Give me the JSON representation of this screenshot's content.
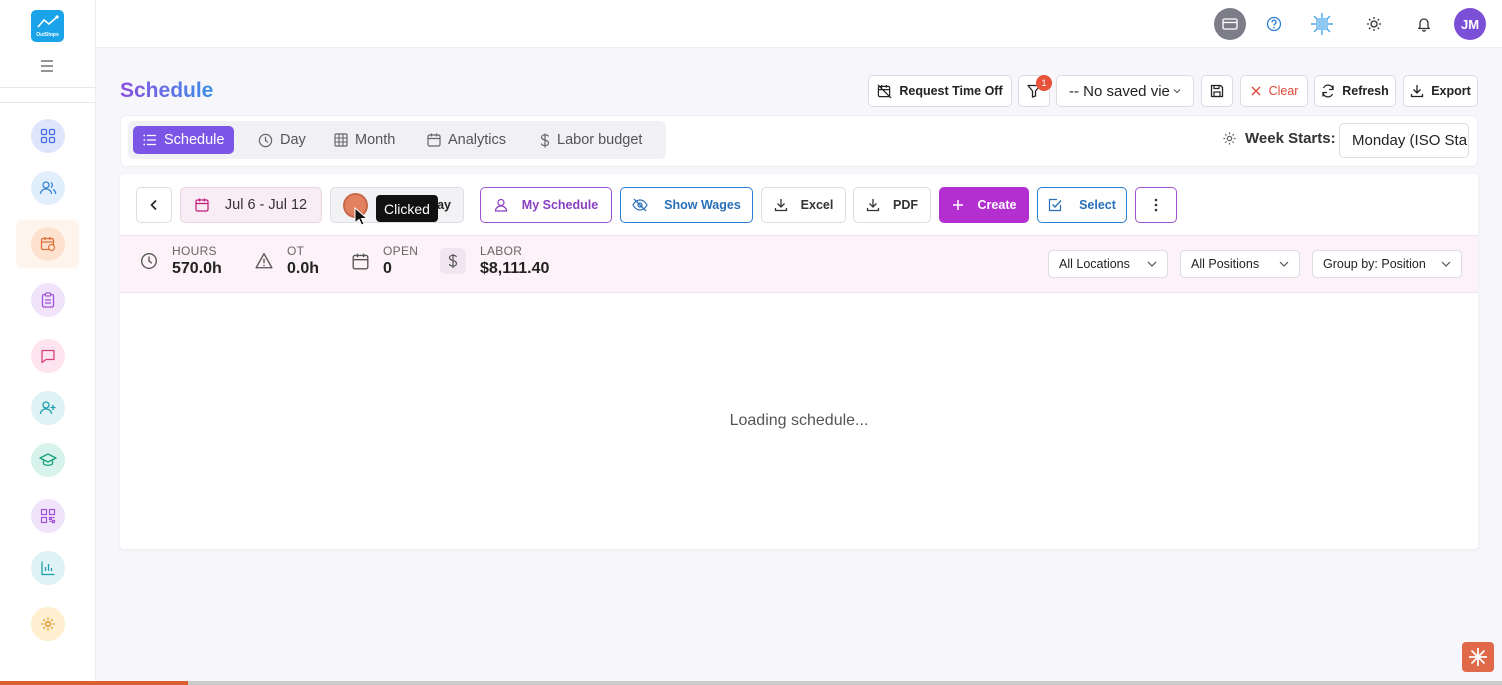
{
  "app": {
    "logo_text": "OutStops"
  },
  "topbar": {
    "avatar_initials": "JM"
  },
  "page": {
    "title": "Schedule"
  },
  "header_actions": {
    "request_time_off": "Request Time Off",
    "filter_badge": "1",
    "saved_view": "-- No saved vie",
    "clear": "Clear",
    "refresh": "Refresh",
    "export": "Export"
  },
  "tabs": [
    {
      "label": "Schedule",
      "icon": "list-icon",
      "active": true
    },
    {
      "label": "Day",
      "icon": "clock-icon"
    },
    {
      "label": "Month",
      "icon": "grid-icon"
    },
    {
      "label": "Analytics",
      "icon": "calendar-icon"
    },
    {
      "label": "Labor budget",
      "icon": "dollar-icon"
    }
  ],
  "week_starts": {
    "label": "Week Starts:",
    "value": "Monday (ISO Standard)"
  },
  "toolbar": {
    "date_range": "Jul 6 - Jul 12",
    "today_partial": "ay",
    "my_schedule": "My Schedule",
    "show_wages": "Show Wages",
    "excel": "Excel",
    "pdf": "PDF",
    "create": "Create",
    "select": "Select"
  },
  "stats": [
    {
      "label": "HOURS",
      "value": "570.0h",
      "icon": "clock-icon"
    },
    {
      "label": "OT",
      "value": "0.0h",
      "icon": "warning-icon"
    },
    {
      "label": "OPEN",
      "value": "0",
      "icon": "calendar-icon"
    },
    {
      "label": "LABOR",
      "value": "$8,111.40",
      "icon": "dollar-icon"
    }
  ],
  "filters": {
    "locations": "All Locations",
    "positions": "All Positions",
    "group_by": "Group by: Position"
  },
  "loading_text": "Loading schedule...",
  "tooltip": "Clicked",
  "colors": {
    "accent": "#7b56e6",
    "create": "#b42fd0",
    "clear": "#e0483a",
    "blue": "#2a7fd4"
  }
}
